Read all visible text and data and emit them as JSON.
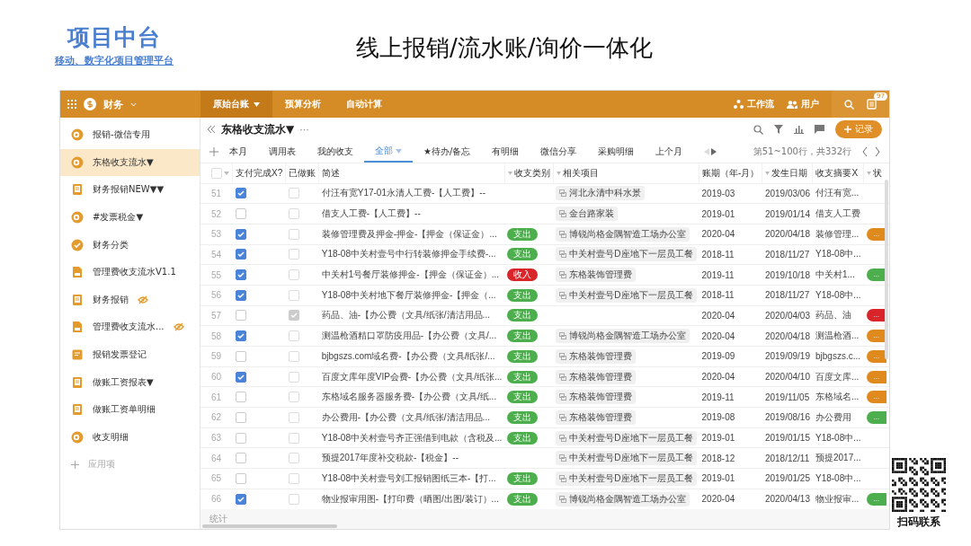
{
  "slide": {
    "brand": "项目中台",
    "tagline": "移动、数字化项目管理平台",
    "title": "线上报销/流水账/询价一体化",
    "qr_caption": "扫码联系"
  },
  "topbar": {
    "app_name": "财务",
    "tabs": [
      {
        "label": "原始台账",
        "selected": true,
        "dropdown": true
      },
      {
        "label": "预算分析",
        "selected": false,
        "dropdown": false
      },
      {
        "label": "自动计算",
        "selected": false,
        "dropdown": false
      }
    ],
    "links": [
      {
        "kind": "workflow",
        "label": "工作流"
      },
      {
        "kind": "users",
        "label": "用户"
      }
    ],
    "notification_count": "97"
  },
  "sidebar": {
    "items": [
      {
        "label": "报销-微信专用",
        "kind": "coin",
        "selected": false,
        "hidden": false
      },
      {
        "label": "东格收支流水▼",
        "kind": "coin",
        "selected": true,
        "hidden": false
      },
      {
        "label": "财务报销NEW▼▼",
        "kind": "book",
        "selected": false,
        "hidden": false
      },
      {
        "label": "#发票税金▼",
        "kind": "coin",
        "selected": false,
        "hidden": false
      },
      {
        "label": "财务分类",
        "kind": "check",
        "selected": false,
        "hidden": false
      },
      {
        "label": "管理费收支流水V1.1",
        "kind": "doc",
        "selected": false,
        "hidden": false
      },
      {
        "label": "财务报销",
        "kind": "book",
        "selected": false,
        "hidden": true
      },
      {
        "label": "管理费收支流水...",
        "kind": "doc",
        "selected": false,
        "hidden": true
      },
      {
        "label": "报销发票登记",
        "kind": "form",
        "selected": false,
        "hidden": false
      },
      {
        "label": "做账工资报表▼",
        "kind": "book",
        "selected": false,
        "hidden": false
      },
      {
        "label": "做账工资单明细",
        "kind": "book",
        "selected": false,
        "hidden": false
      },
      {
        "label": "收支明细",
        "kind": "coin",
        "selected": false,
        "hidden": false
      }
    ],
    "add_label": "应用项"
  },
  "sheet": {
    "title": "东格收支流水▼",
    "more": "···",
    "add_button": "记录",
    "views": [
      {
        "label": "本月",
        "selected": false
      },
      {
        "label": "调用表",
        "selected": false
      },
      {
        "label": "我的收支",
        "selected": false
      },
      {
        "label": "全部",
        "selected": true
      },
      {
        "label": "★待办/备忘",
        "selected": false
      },
      {
        "label": "有明细",
        "selected": false
      },
      {
        "label": "微信分享",
        "selected": false
      },
      {
        "label": "采购明细",
        "selected": false
      },
      {
        "label": "上个月",
        "selected": false
      }
    ],
    "range": "第51~100行，共332行",
    "footer": "统计"
  },
  "table": {
    "all_selected": false,
    "columns": [
      {
        "label": "支付完成X?",
        "filter": false
      },
      {
        "label": "已做账",
        "filter": false
      },
      {
        "label": "简述",
        "filter": false
      },
      {
        "label": "收支类别",
        "filter": true
      },
      {
        "label": "相关项目",
        "filter": true
      },
      {
        "label": "账期（年-月）",
        "filter": false
      },
      {
        "label": "发生日期",
        "filter": true
      },
      {
        "label": "收支摘要X",
        "filter": false
      },
      {
        "label": "状",
        "filter": true
      }
    ],
    "rows": [
      {
        "no": "51",
        "paid": true,
        "done": false,
        "desc": "付汪有宽Y17-01永清人工费-【人工费】--",
        "project": "河北永清中科水景",
        "period": "2019-03",
        "date": "2019/03/06",
        "summary": "付汪有宽..."
      },
      {
        "no": "52",
        "paid": false,
        "done": false,
        "desc": "借支人工费-【人工费】--",
        "project": "金台路家装",
        "period": "2019-01",
        "date": "2019/01/14",
        "summary": "借支人工费"
      },
      {
        "no": "53",
        "paid": true,
        "done": false,
        "desc": "装修管理费及押金-押金-【押金（保证金）...",
        "type": {
          "label": "支出",
          "color": "#4cae4c"
        },
        "project": "博锐尚格金隅智造工场办公室",
        "period": "2020-04",
        "date": "2020/04/18",
        "summary": "装修管理...",
        "status": {
          "label": "...",
          "color": "#e08a1e"
        }
      },
      {
        "no": "54",
        "paid": true,
        "done": false,
        "desc": "Y18-08中关村壹号中行转装修押金手续费-...",
        "type": {
          "label": "支出",
          "color": "#4cae4c"
        },
        "project": "中关村壹号D座地下一层员工餐",
        "period": "2018-11",
        "date": "2018/11/27",
        "summary": "Y18-08中..."
      },
      {
        "no": "55",
        "paid": true,
        "done": false,
        "desc": "中关村1号餐厅装修押金-【押金（保证金）...",
        "type": {
          "label": "收入",
          "color": "#d9252a"
        },
        "project": "东格装饰管理费",
        "period": "2019-11",
        "date": "2019/10/18",
        "summary": "中关村1...",
        "status": {
          "label": "...",
          "color": "#4cae4c"
        }
      },
      {
        "no": "56",
        "paid": true,
        "done": false,
        "desc": "Y18-08中关村地下餐厅装修押金-【押金（...",
        "type": {
          "label": "支出",
          "color": "#4cae4c"
        },
        "project": "中关村壹号D座地下一层员工餐",
        "period": "2018-11",
        "date": "2018/11/27",
        "summary": "Y18-08中..."
      },
      {
        "no": "57",
        "paid": false,
        "done": true,
        "desc": "药品、油-【办公费（文具/纸张/清洁用品...",
        "type": {
          "label": "支出",
          "color": "#4cae4c"
        },
        "period": "2020-04",
        "date": "2020/04/03",
        "summary": "药品、油",
        "status": {
          "label": "...",
          "color": "#d9252a"
        }
      },
      {
        "no": "58",
        "paid": true,
        "done": false,
        "desc": "测温枪酒精口罩防疫用品-【办公费（文具/...",
        "type": {
          "label": "支出",
          "color": "#4cae4c"
        },
        "project": "博锐尚格金隅智造工场办公室",
        "period": "2020-04",
        "date": "2020/04/18",
        "summary": "测温枪酒...",
        "status": {
          "label": "...",
          "color": "#e08a1e"
        }
      },
      {
        "no": "59",
        "paid": false,
        "done": false,
        "desc": "bjbgszs.com域名费-【办公费（文具/纸张/...",
        "type": {
          "label": "支出",
          "color": "#4cae4c"
        },
        "project": "东格装饰管理费",
        "period": "2019-09",
        "date": "2019/09/19",
        "summary": "bjbgszs.c...",
        "status": {
          "label": "...",
          "color": "#e08a1e"
        }
      },
      {
        "no": "60",
        "paid": true,
        "done": false,
        "desc": "百度文库年度VIP会费-【办公费（文具/纸张...",
        "type": {
          "label": "支出",
          "color": "#4cae4c"
        },
        "project": "东格装饰管理费",
        "period": "2020-04",
        "date": "2020/04/10",
        "summary": "百度文库...",
        "status": {
          "label": "...",
          "color": "#e08a1e"
        }
      },
      {
        "no": "61",
        "paid": false,
        "done": false,
        "desc": "东格域名服务器服务费-【办公费（文具/纸...",
        "type": {
          "label": "支出",
          "color": "#4cae4c"
        },
        "project": "东格装饰管理费",
        "period": "2019-11",
        "date": "2019/11/05",
        "summary": "东格域名...",
        "status": {
          "label": "...",
          "color": "#e08a1e"
        }
      },
      {
        "no": "62",
        "paid": false,
        "done": false,
        "desc": "办公费用-【办公费（文具/纸张/清洁用品...",
        "type": {
          "label": "支出",
          "color": "#4cae4c"
        },
        "project": "东格装饰管理费",
        "period": "2019-08",
        "date": "2019/08/16",
        "summary": "办公费用",
        "status": {
          "label": "...",
          "color": "#4cae4c"
        }
      },
      {
        "no": "63",
        "paid": false,
        "done": false,
        "desc": "Y18-08中关村壹号齐正强借到电款（含税及...",
        "type": {
          "label": "支出",
          "color": "#4cae4c"
        },
        "project": "中关村壹号D座地下一层员工餐",
        "period": "2019-01",
        "date": "2019/01/15",
        "summary": "Y18-08中..."
      },
      {
        "no": "64",
        "paid": false,
        "done": false,
        "desc": "预提2017年度补交税款-【税金】--",
        "project": "中关村壹号D座地下一层员工餐",
        "period": "2018-12",
        "date": "2018/12/11",
        "summary": "预提2017..."
      },
      {
        "no": "65",
        "paid": false,
        "done": false,
        "desc": "Y18-08中关村壹号刘工报销图纸三本-【打...",
        "type": {
          "label": "支出",
          "color": "#4cae4c"
        },
        "project": "中关村壹号D座地下一层员工餐",
        "period": "2019-01",
        "date": "2019/01/25",
        "summary": "Y18-08中..."
      },
      {
        "no": "66",
        "paid": true,
        "done": false,
        "desc": "物业报审用图-【打印费（晒图/出图/装订）...",
        "type": {
          "label": "支出",
          "color": "#4cae4c"
        },
        "project": "博锐尚格金隅智造工场办公室",
        "period": "2020-04",
        "date": "2020/04/13",
        "summary": "物业报审...",
        "status": {
          "label": "...",
          "color": "#4cae4c"
        }
      }
    ]
  }
}
